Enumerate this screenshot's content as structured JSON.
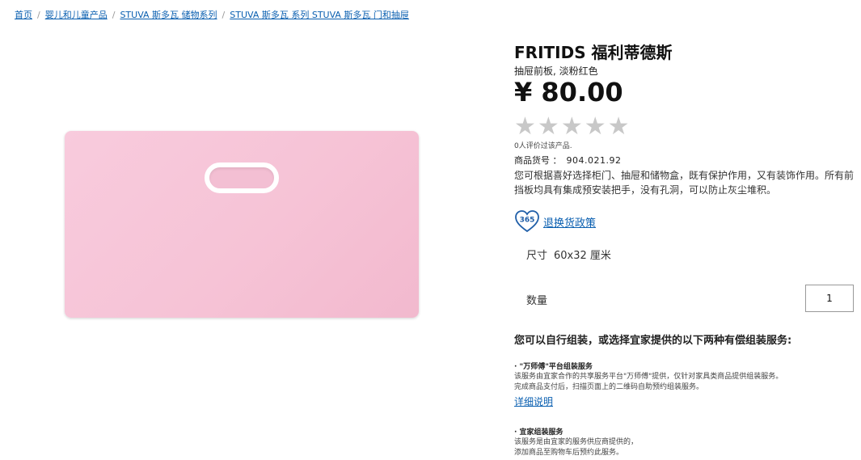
{
  "breadcrumb": {
    "items": [
      "首页",
      "婴儿和儿童产品",
      "STUVA 斯多瓦 储物系列",
      "STUVA 斯多瓦 系列 STUVA 斯多瓦 门和抽屉"
    ],
    "separator": "/"
  },
  "product": {
    "title": "FRITIDS 福利蒂德斯",
    "subtitle": "抽屉前板, 淡粉红色",
    "price": "¥ 80.00",
    "rating": {
      "stars_filled": 0,
      "stars_total": 5
    },
    "review_count": "0人评价过该产品.",
    "article_label": "商品货号 ：",
    "article_number": "904.021.92",
    "description": "您可根据喜好选择柜门、抽屉和储物盒，既有保护作用，又有装饰作用。所有前挡板均具有集成预安装把手，没有孔洞，可以防止灰尘堆积。",
    "return_badge": "365",
    "return_policy_link": "退换货政策",
    "size_label": "尺寸",
    "size_value": "60x32 厘米",
    "quantity_label": "数量",
    "quantity_value": "1",
    "image_color": "#f6c3d6"
  },
  "assembly": {
    "heading": "您可以自行组装，或选择宜家提供的以下两种有偿组装服务:",
    "services": [
      {
        "title": "· \"万师傅\"平台组装服务",
        "lines": [
          "该服务由宜家合作的共享服务平台\"万师傅\"提供，仅针对家具类商品提供组装服务。",
          "完成商品支付后，扫描页面上的二维码自助预约组装服务。"
        ],
        "link": "详细说明"
      },
      {
        "title": "· 宜家组装服务",
        "lines": [
          "该服务是由宜家的服务供应商提供的，",
          "添加商品至购物车后预约此服务。"
        ]
      }
    ]
  },
  "colors": {
    "link": "#0a5fb0",
    "star_empty": "#c8c8c8",
    "badge": "#1f5ea8"
  }
}
